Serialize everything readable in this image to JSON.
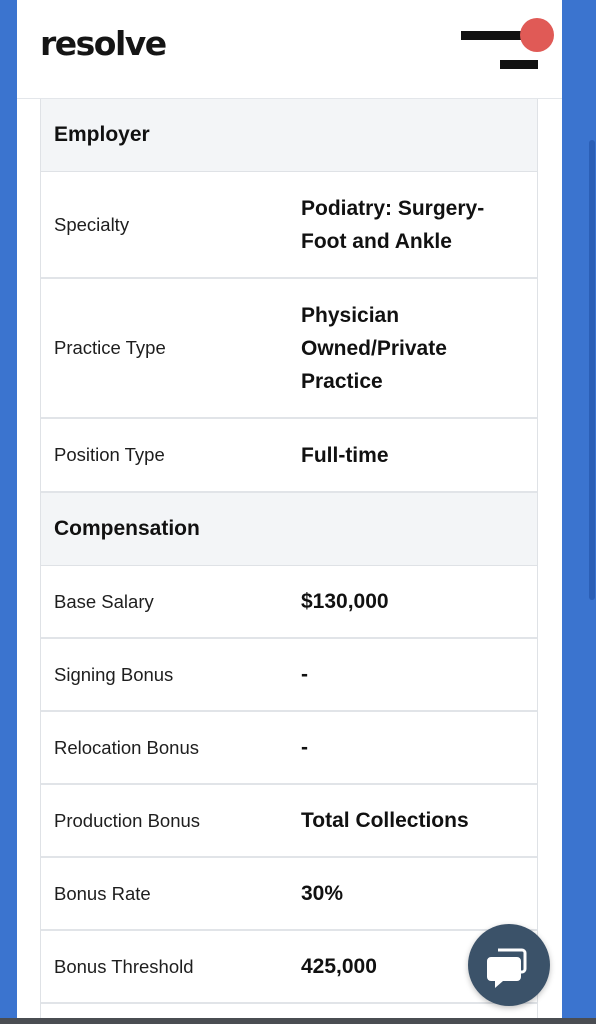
{
  "header": {
    "logo_text": "resolve",
    "menu_icon": "hamburger-menu-icon",
    "notification_color": "#e05a56"
  },
  "employer": {
    "title": "Employer",
    "rows": [
      {
        "label": "Specialty",
        "value": "Podiatry: Surgery- Foot and Ankle"
      },
      {
        "label": "Practice Type",
        "value": "Physician Owned/Private Practice"
      },
      {
        "label": "Position Type",
        "value": "Full-time"
      }
    ]
  },
  "compensation": {
    "title": "Compensation",
    "rows": [
      {
        "label": "Base Salary",
        "value": "$130,000"
      },
      {
        "label": "Signing Bonus",
        "value": "-"
      },
      {
        "label": "Relocation Bonus",
        "value": "-"
      },
      {
        "label": "Production Bonus",
        "value": "Total Collections"
      },
      {
        "label": "Bonus Rate",
        "value": "30%"
      },
      {
        "label": "Bonus Threshold",
        "value": "425,000"
      }
    ]
  },
  "chat": {
    "icon": "chat-bubble-icon"
  },
  "colors": {
    "page_bg": "#3b74cf",
    "section_bg": "#f3f5f7",
    "chat_bg": "#3b5269"
  }
}
